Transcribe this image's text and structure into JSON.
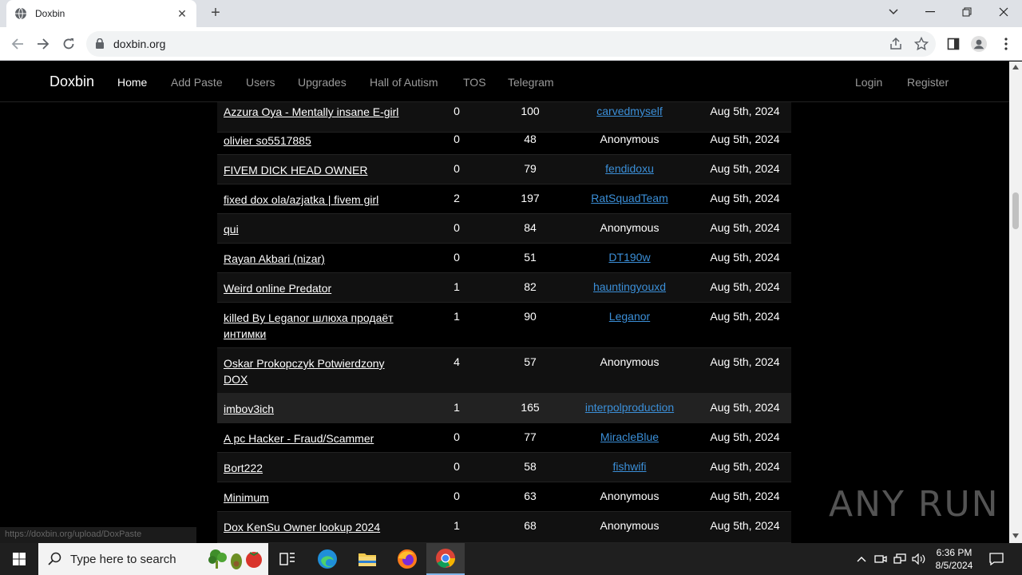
{
  "browser": {
    "tab_title": "Doxbin",
    "url": "doxbin.org",
    "status_url": "https://doxbin.org/upload/DoxPaste"
  },
  "site": {
    "brand": "Doxbin",
    "nav": [
      "Home",
      "Add Paste",
      "Users",
      "Upgrades",
      "Hall of Autism",
      "TOS",
      "Telegram"
    ],
    "auth": [
      "Login",
      "Register"
    ]
  },
  "rows": [
    {
      "title": "Azzura Oya - Mentally insane E-girl",
      "comments": "0",
      "views": "100",
      "user": "carvedmyself",
      "user_link": true,
      "date": "Aug 5th, 2024"
    },
    {
      "title": "olivier so5517885",
      "comments": "0",
      "views": "48",
      "user": "Anonymous",
      "user_link": false,
      "date": "Aug 5th, 2024"
    },
    {
      "title": "FIVEM DICK HEAD OWNER",
      "comments": "0",
      "views": "79",
      "user": "fendidoxu",
      "user_link": true,
      "date": "Aug 5th, 2024"
    },
    {
      "title": "fixed dox ola/azjatka | fivem girl",
      "comments": "2",
      "views": "197",
      "user": "RatSquadTeam",
      "user_link": true,
      "date": "Aug 5th, 2024"
    },
    {
      "title": "qui",
      "comments": "0",
      "views": "84",
      "user": "Anonymous",
      "user_link": false,
      "date": "Aug 5th, 2024"
    },
    {
      "title": "Rayan Akbari (nizar)",
      "comments": "0",
      "views": "51",
      "user": "DT190w",
      "user_link": true,
      "date": "Aug 5th, 2024"
    },
    {
      "title": "Weird online Predator",
      "comments": "1",
      "views": "82",
      "user": "hauntingyouxd",
      "user_link": true,
      "date": "Aug 5th, 2024"
    },
    {
      "title": "killed By Leganor шлюха продаёт интимки",
      "comments": "1",
      "views": "90",
      "user": "Leganor",
      "user_link": true,
      "date": "Aug 5th, 2024"
    },
    {
      "title": "Oskar Prokopczyk Potwierdzony DOX",
      "comments": "4",
      "views": "57",
      "user": "Anonymous",
      "user_link": false,
      "date": "Aug 5th, 2024"
    },
    {
      "title": "imbov3ich",
      "comments": "1",
      "views": "165",
      "user": "interpolproduction",
      "user_link": true,
      "date": "Aug 5th, 2024"
    },
    {
      "title": "A pc Hacker - Fraud/Scammer",
      "comments": "0",
      "views": "77",
      "user": "MiracleBlue",
      "user_link": true,
      "date": "Aug 5th, 2024"
    },
    {
      "title": "Bort222",
      "comments": "0",
      "views": "58",
      "user": "fishwifi",
      "user_link": true,
      "date": "Aug 5th, 2024"
    },
    {
      "title": "Minimum",
      "comments": "0",
      "views": "63",
      "user": "Anonymous",
      "user_link": false,
      "date": "Aug 5th, 2024"
    },
    {
      "title": "Dox KenSu Owner lookup 2024",
      "comments": "1",
      "views": "68",
      "user": "Anonymous",
      "user_link": false,
      "date": "Aug 5th, 2024"
    }
  ],
  "watermark": "ANY RUN",
  "taskbar": {
    "search_placeholder": "Type here to search",
    "time": "6:36 PM",
    "date": "8/5/2024"
  }
}
